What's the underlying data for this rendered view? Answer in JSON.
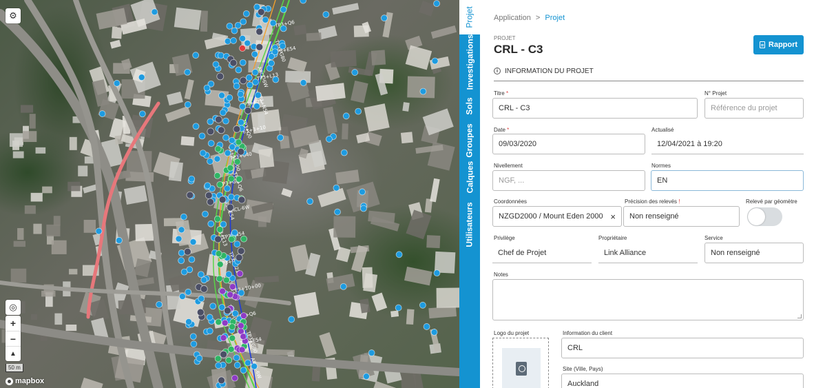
{
  "map": {
    "scale_label": "50 m",
    "attribution": "mapbox",
    "road_labels": [
      "TP3+Q6",
      "TP3+G80",
      "TP3+E54",
      "ARCL-6W",
      "TP3+L13",
      "TP3+N54",
      "TP3+E21",
      "TP3+Q0",
      "E3+3+10",
      "E3+10+00",
      "TP3+040"
    ],
    "colors": {
      "marker_blue": "#1e9be0",
      "marker_green": "#2fb565",
      "marker_purple": "#8e3bc6",
      "marker_dark": "#4b4f66",
      "marker_red": "#e13b3b",
      "road_pink": "#e7777b",
      "line_blue": "#1f3cd9",
      "line_green": "#5ad447",
      "line_orange": "#f0a030"
    }
  },
  "tabs": [
    {
      "label": "Projet",
      "active": true
    },
    {
      "label": "Investigations",
      "active": false
    },
    {
      "label": "Sols",
      "active": false
    },
    {
      "label": "Groupes",
      "active": false
    },
    {
      "label": "Calques",
      "active": false
    },
    {
      "label": "Utilisateurs",
      "active": false
    }
  ],
  "breadcrumb": {
    "root": "Application",
    "separator": ">",
    "current": "Projet"
  },
  "header": {
    "small_label": "PROJET",
    "title": "CRL - C3",
    "report_label": "Rapport"
  },
  "section": {
    "title": "INFORMATION DU PROJET"
  },
  "form": {
    "titre": {
      "label": "Titre",
      "required": "*",
      "value": "CRL - C3"
    },
    "numero": {
      "label": "N° Projet",
      "placeholder": "Référence du projet"
    },
    "date": {
      "label": "Date",
      "required": "*",
      "value": "09/03/2020"
    },
    "actualise": {
      "label": "Actualisé",
      "value": "12/04/2021 à 19:20"
    },
    "nivellement": {
      "label": "Nivellement",
      "placeholder": "NGF, ..."
    },
    "normes": {
      "label": "Normes",
      "value": "EN"
    },
    "coordonnees": {
      "label": "Coordonnées",
      "value": "NZGD2000 / Mount Eden 2000"
    },
    "precision": {
      "label": "Précision des relevés",
      "required": "!",
      "value": "Non renseigné"
    },
    "releve": {
      "label": "Relevé par géomètre"
    },
    "privilege": {
      "label": "Privilège",
      "value": "Chef de Projet"
    },
    "proprietaire": {
      "label": "Propriétaire",
      "value": "Link Alliance"
    },
    "service": {
      "label": "Service",
      "value": "Non renseigné"
    },
    "notes": {
      "label": "Notes"
    },
    "logo": {
      "label": "Logo du projet"
    },
    "client": {
      "label": "Information du client",
      "value": "CRL"
    },
    "site": {
      "label": "Site (Ville, Pays)",
      "value": "Auckland"
    }
  }
}
